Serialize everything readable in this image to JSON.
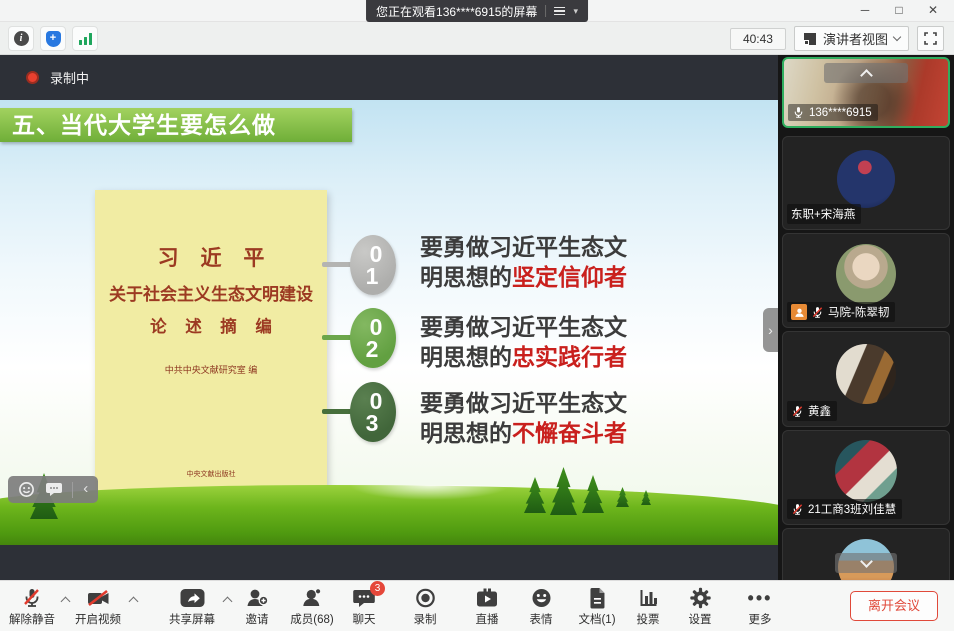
{
  "titlebar": {
    "viewing": "您正在观看136****6915的屏幕"
  },
  "topbar": {
    "timer": "40:43",
    "view_mode": "演讲者视图"
  },
  "share": {
    "recording_label": "录制中",
    "slide": {
      "header": "五、当代大学生要怎么做",
      "book": {
        "l1": "习 近 平",
        "l2": "关于社会主义生态文明建设",
        "l3": "论 述 摘 编",
        "editor": "中共中央文献研究室  编",
        "publisher": "中央文献出版社"
      },
      "items": [
        {
          "d1": "0",
          "d2": "1",
          "plain": "要勇做习近平生态文明思想的",
          "em": "坚定信仰者"
        },
        {
          "d1": "0",
          "d2": "2",
          "plain": "要勇做习近平生态文明思想的",
          "em": "忠实践行者"
        },
        {
          "d1": "0",
          "d2": "3",
          "plain": "要勇做习近平生态文明思想的",
          "em": "不懈奋斗者"
        }
      ]
    }
  },
  "participants": [
    {
      "name": "136****6915",
      "mic": "on",
      "active_speaker": true
    },
    {
      "name": "东职+宋海燕",
      "mic": "none"
    },
    {
      "name": "马院-陈翠韧",
      "mic": "muted",
      "role_badge": "host"
    },
    {
      "name": "黄鑫",
      "mic": "muted"
    },
    {
      "name": "21工商3班刘佳慧",
      "mic": "muted"
    }
  ],
  "toolbar": {
    "items": [
      {
        "label": "解除静音"
      },
      {
        "label": "开启视频"
      },
      {
        "label": "共享屏幕"
      },
      {
        "label": "邀请"
      },
      {
        "label": "成员(68)"
      },
      {
        "label": "聊天"
      },
      {
        "label": "录制"
      },
      {
        "label": "直播"
      },
      {
        "label": "表情"
      },
      {
        "label": "文档(1)"
      },
      {
        "label": "投票"
      },
      {
        "label": "设置"
      },
      {
        "label": "更多"
      }
    ],
    "chat_badge": "3",
    "leave": "离开会议"
  },
  "colors": {
    "banner_green": "#6fae38",
    "item1_gray": "#b4b4b2",
    "item2_green": "#6ca64b",
    "item3_green": "#476f3c",
    "emphasis_red": "#c9201d",
    "book_bg": "#f1eca3",
    "book_text": "#9c3a22",
    "record_red": "#e8402f",
    "leave_red": "#e0493a",
    "active_speaker_green": "#2fae5f",
    "host_badge_orange": "#e78a35",
    "shield_blue": "#2878e0",
    "signal_green": "#1ea65c"
  }
}
